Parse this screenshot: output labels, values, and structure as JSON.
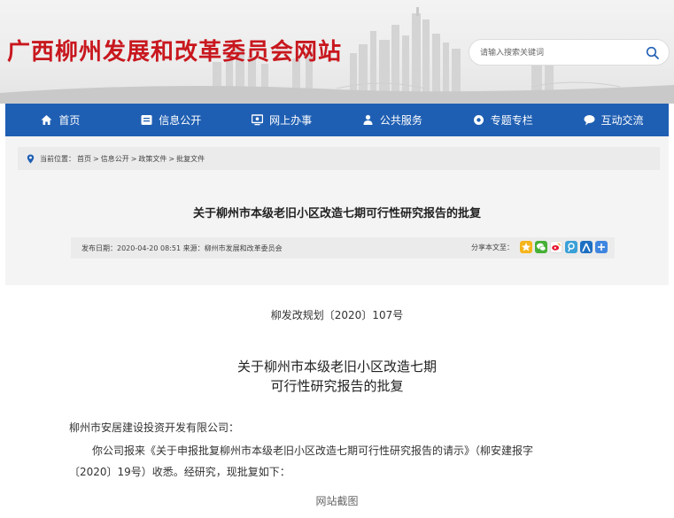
{
  "header": {
    "site_title": "广西柳州发展和改革委员会网站",
    "search_placeholder": "请输入搜索关键词"
  },
  "nav": {
    "items": [
      {
        "label": "首页",
        "icon": "home-icon"
      },
      {
        "label": "信息公开",
        "icon": "info-icon"
      },
      {
        "label": "网上办事",
        "icon": "monitor-icon"
      },
      {
        "label": "公共服务",
        "icon": "person-icon"
      },
      {
        "label": "专题专栏",
        "icon": "gear-icon"
      },
      {
        "label": "互动交流",
        "icon": "chat-icon"
      }
    ]
  },
  "breadcrumb": {
    "prefix": "当前位置：",
    "items": [
      "首页",
      "信息公开",
      "政策文件",
      "批复文件"
    ],
    "sep": ">"
  },
  "article": {
    "title": "关于柳州市本级老旧小区改造七期可行性研究报告的批复",
    "meta": "发布日期：2020-04-20 08:51 来源：柳州市发展和改革委员会",
    "share_label": "分享本文至：",
    "share_icons": [
      "qzone-icon",
      "wechat-icon",
      "weibo-icon",
      "tencent-weibo-icon",
      "renren-icon",
      "more-share-icon"
    ]
  },
  "document": {
    "doc_no": "柳发改规划〔2020〕107号",
    "title_line1": "关于柳州市本级老旧小区改造七期",
    "title_line2": "可行性研究报告的批复",
    "recipient": "柳州市安居建设投资开发有限公司：",
    "para_line1": "你公司报来《关于申报批复柳州市本级老旧小区改造七期可行性研究报告的请示》（柳安建报字",
    "para_line2": "〔2020〕19号）收悉。经研究，现批复如下："
  },
  "caption": "网站截图",
  "colors": {
    "brand_red": "#c8171e",
    "nav_blue": "#1f5fb3"
  }
}
